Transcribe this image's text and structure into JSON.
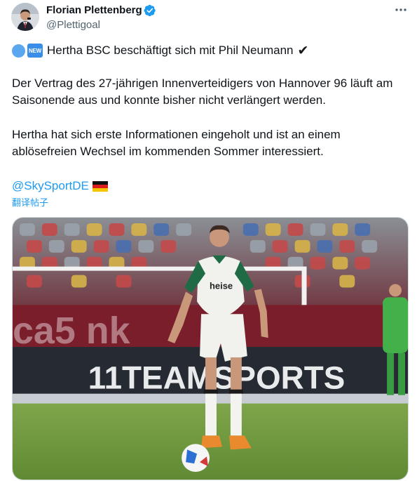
{
  "author": {
    "display_name": "Florian Plettenberg",
    "handle": "@Plettigoal",
    "verified": true
  },
  "tweet": {
    "headline": "Hertha BSC beschäftigt sich mit Phil Neumann",
    "headline_badge": "NEW",
    "headline_icon": "heavy-check-mark",
    "paragraph1_line1": "Der Vertrag des 27-jährigen Innenverteidigers von Hannover 96 läuft am",
    "paragraph1_line2": "Saisonende aus und konnte bisher nicht verlängert werden.",
    "paragraph2_line1": "Hertha hat sich erste Informationen eingeholt und ist an einem",
    "paragraph2_line2": "ablösefreien Wechsel im kommenden Sommer interessiert.",
    "mention": "@SkySportDE",
    "mention_flag": "germany-flag",
    "translate_label": "翻译帖子"
  },
  "media": {
    "description_icon": "football-player-photo",
    "jersey_sponsor": "heise",
    "board_text": "11TEAMSPORTS"
  },
  "colors": {
    "link": "#1d9bf0",
    "secondary_text": "#536471",
    "verified": "#1d9bf0",
    "jersey_green": "#1f6b45"
  }
}
